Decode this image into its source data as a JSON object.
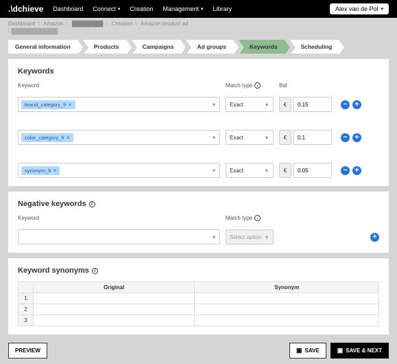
{
  "topbar": {
    "logo": ".\\dchieve",
    "nav": [
      "Dashboard",
      "Connect",
      "Creation",
      "Management",
      "Library"
    ],
    "nav_has_caret": [
      false,
      true,
      false,
      true,
      false
    ],
    "user": "Alex van de Pol"
  },
  "breadcrumb": {
    "items": [
      "Dashboard",
      "Amazon",
      "████████",
      "Creation",
      "Amazon product ad"
    ],
    "sub": "\\  ████████████"
  },
  "steps": {
    "items": [
      "General information",
      "Products",
      "Campaigns",
      "Ad groups",
      "Keywords",
      "Scheduling"
    ],
    "active_index": 4
  },
  "keywords_panel": {
    "title": "Keywords",
    "headers": {
      "keyword": "Keyword",
      "match_type": "Match type",
      "bid": "Bid"
    },
    "currency": "€",
    "rows": [
      {
        "tag": "brand_category_fr",
        "match": "Exact",
        "bid": "0.15"
      },
      {
        "tag": "color_category_fr",
        "match": "Exact",
        "bid": "0.1"
      },
      {
        "tag": "synonym_fr",
        "match": "Exact",
        "bid": "0.05"
      }
    ]
  },
  "negative_panel": {
    "title": "Negative keywords",
    "headers": {
      "keyword": "Keyword",
      "match_type": "Match type"
    },
    "placeholder": "Select option"
  },
  "synonyms_panel": {
    "title": "Keyword synonyms",
    "columns": {
      "original": "Original",
      "synonym": "Synonym"
    },
    "row_indexes": [
      "1",
      "2",
      "3"
    ]
  },
  "footer": {
    "preview": "PREVIEW",
    "save": "SAVE",
    "save_next": "SAVE & NEXT"
  }
}
